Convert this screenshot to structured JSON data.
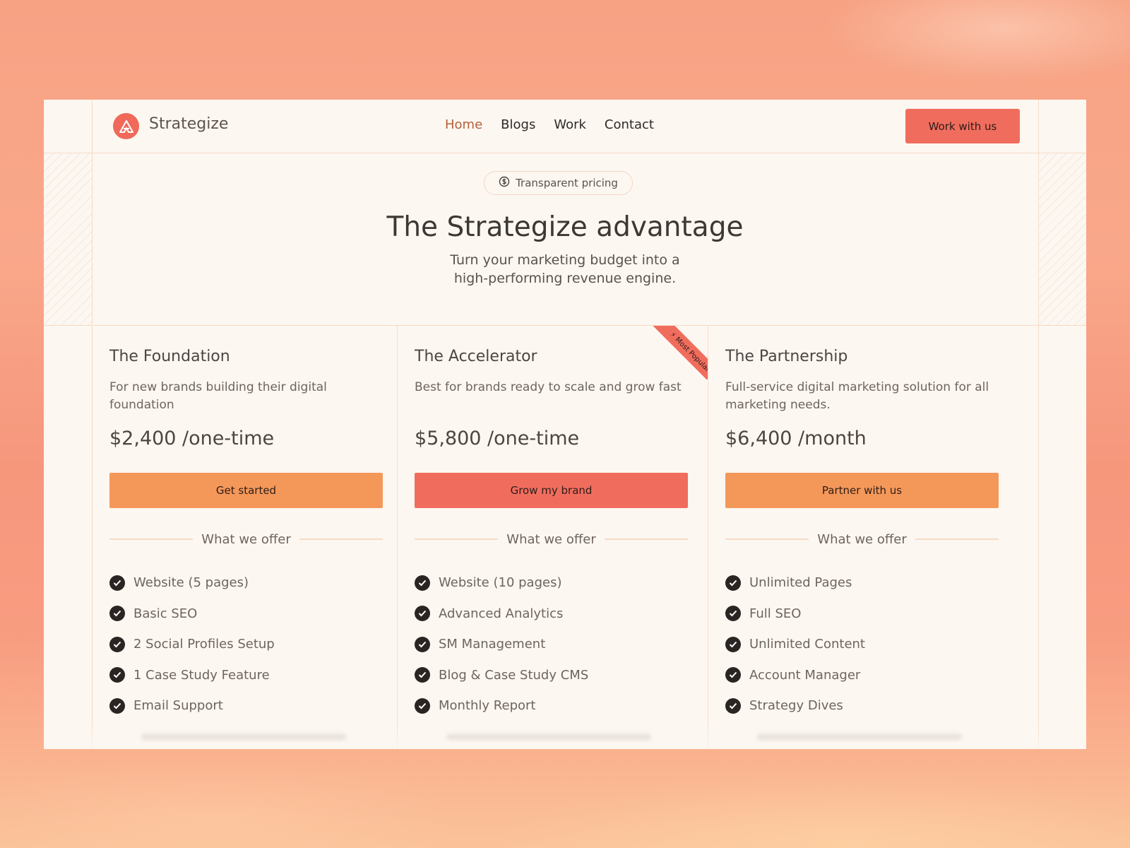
{
  "header": {
    "brand": "Strategize",
    "nav": [
      {
        "label": "Home",
        "active": true
      },
      {
        "label": "Blogs",
        "active": false
      },
      {
        "label": "Work",
        "active": false
      },
      {
        "label": "Contact",
        "active": false
      }
    ],
    "cta_label": "Work with us"
  },
  "hero": {
    "badge": "Transparent pricing",
    "badge_icon": "dollar-circle-icon",
    "title": "The Strategize advantage",
    "subtitle_line1": "Turn your marketing budget into a",
    "subtitle_line2": "high-performing revenue engine."
  },
  "plans": [
    {
      "name": "The Foundation",
      "description": "For new brands building their digital foundation",
      "price": "$2,400 /one-time",
      "button": "Get started",
      "button_color": "#f4985a",
      "offer_label": "What we offer",
      "features": [
        "Website (5 pages)",
        "Basic SEO",
        "2 Social Profiles Setup",
        "1 Case Study Feature",
        "Email Support"
      ]
    },
    {
      "name": "The Accelerator",
      "description": "Best for brands ready to scale and grow fast",
      "price": "$5,800 /one-time",
      "button": "Grow my brand",
      "button_color": "#f06d5e",
      "offer_label": "What we offer",
      "ribbon": "⚡ Most Popular",
      "features": [
        "Website (10 pages)",
        "Advanced Analytics",
        "SM Management",
        "Blog & Case Study CMS",
        "Monthly Report"
      ]
    },
    {
      "name": "The Partnership",
      "description": "Full-service digital marketing solution for all marketing needs.",
      "price": "$6,400 /month",
      "button": "Partner with us",
      "button_color": "#f4985a",
      "offer_label": "What we offer",
      "features": [
        "Unlimited Pages",
        "Full SEO",
        "Unlimited Content",
        "Account Manager",
        "Strategy Dives"
      ]
    }
  ],
  "colors": {
    "accent": "#f06d5e",
    "orange": "#f4985a",
    "background": "#fdf7f1",
    "check": "#2a2523"
  }
}
